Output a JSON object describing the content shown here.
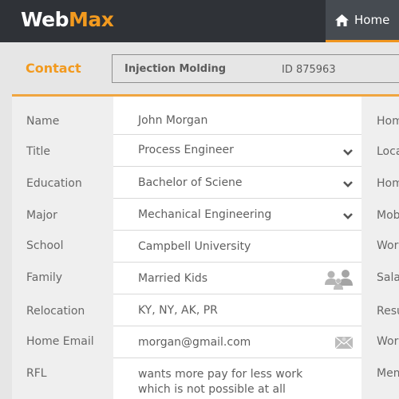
{
  "app": {
    "logo_part1": "Web",
    "logo_part2": "Max",
    "brand_color": "#f29a1f"
  },
  "nav": {
    "home_label": "Home",
    "home_icon": "home-icon"
  },
  "header": {
    "section_title": "Contact",
    "company": "Injection Molding",
    "id_text": "ID 875963"
  },
  "form": {
    "rows": [
      {
        "label": "Name",
        "value": "John Morgan"
      },
      {
        "label": "Title",
        "value": "Process Engineer",
        "control": "dropdown"
      },
      {
        "label": "Education",
        "value": "Bachelor of Sciene",
        "control": "dropdown"
      },
      {
        "label": "Major",
        "value": "Mechanical Engineering",
        "control": "dropdown"
      },
      {
        "label": "School",
        "value": "Campbell University"
      },
      {
        "label": "Family",
        "value": "Married Kids",
        "icon": "family-icon"
      },
      {
        "label": "Relocation",
        "value": " KY, NY, AK, PR"
      },
      {
        "label": "Home Email",
        "value": "morgan@gmail.com",
        "icon": "mail-icon"
      },
      {
        "label": "RFL",
        "value_line1": "wants more pay for less work",
        "value_line2": "which is not possible at all"
      }
    ]
  },
  "right_column": {
    "labels": [
      "Hom",
      "Loca",
      "Hom",
      "Mob",
      "Wor",
      "Sala",
      "Resu",
      "Wor",
      "Mem"
    ]
  }
}
